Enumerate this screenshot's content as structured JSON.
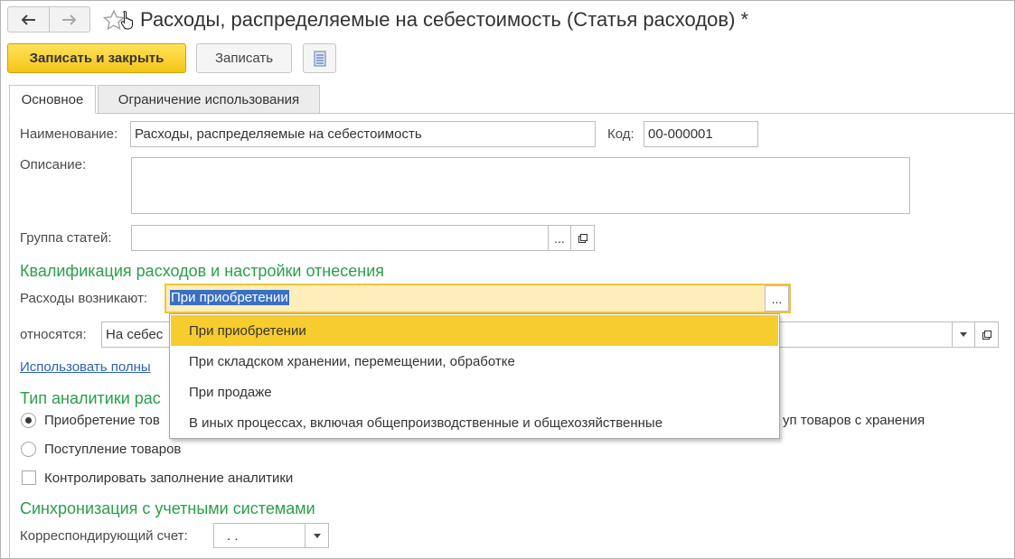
{
  "window": {
    "title": "Расходы, распределяемые на себестоимость (Статья расходов) *"
  },
  "nav": {
    "back_icon": "arrow-left-icon",
    "forward_icon": "arrow-right-icon",
    "favorite_icon": "star-icon"
  },
  "toolbar": {
    "save_close_label": "Записать и закрыть",
    "save_label": "Записать",
    "report_icon": "document-list-icon"
  },
  "tabs": [
    {
      "label": "Основное",
      "active": true
    },
    {
      "label": "Ограничение использования",
      "active": false
    }
  ],
  "form": {
    "name_label": "Наименование:",
    "name_value": "Расходы, распределяемые на себестоимость",
    "code_label": "Код:",
    "code_value": "00-000001",
    "description_label": "Описание:",
    "description_value": "",
    "group_label": "Группа статей:",
    "group_value": "",
    "ellipsis": "...",
    "section_qualification": "Квалификация расходов и настройки отнесения",
    "expenses_arise_label": "Расходы возникают:",
    "expenses_arise_value": "При приобретении",
    "assigned_label": "относятся:",
    "assigned_value_visible": "На себес",
    "use_full_link_visible": "Использовать полны",
    "section_analytics_visible": "Тип аналитики рас",
    "radio_acquisition_visible": "Приобретение тов",
    "radio_right_visible": "уп товаров с хранения",
    "radio_receipt": "Поступление товаров",
    "checkbox_control": "Контролировать заполнение аналитики",
    "section_sync": "Синхронизация с учетными системами",
    "corr_account_label": "Корреспондирующий счет:",
    "corr_account_value": ".   ."
  },
  "dropdown": {
    "items": [
      "При приобретении",
      "При складском хранении, перемещении, обработке",
      "При продаже",
      "В иных процессах, включая общепроизводственные и общехозяйственные"
    ],
    "selected_index": 0
  },
  "colors": {
    "accent_green": "#2a9f48",
    "primary_yellow": "#f5c518",
    "link_blue": "#2c63b4",
    "selection_blue": "#3a6fc4"
  }
}
